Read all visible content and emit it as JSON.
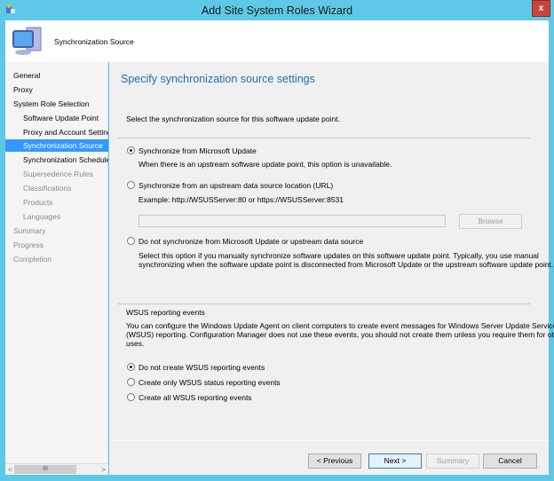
{
  "window": {
    "title": "Add Site System Roles Wizard",
    "close": "x"
  },
  "header": {
    "title": "Synchronization Source"
  },
  "nav": {
    "items": [
      {
        "label": "General",
        "level": 0,
        "state": "normal"
      },
      {
        "label": "Proxy",
        "level": 0,
        "state": "normal"
      },
      {
        "label": "System Role Selection",
        "level": 0,
        "state": "normal"
      },
      {
        "label": "Software Update Point",
        "level": 1,
        "state": "normal"
      },
      {
        "label": "Proxy and Account Settings",
        "level": 1,
        "state": "normal"
      },
      {
        "label": "Synchronization Source",
        "level": 1,
        "state": "selected"
      },
      {
        "label": "Synchronization Schedule",
        "level": 1,
        "state": "normal"
      },
      {
        "label": "Supersedence Rules",
        "level": 1,
        "state": "disabled"
      },
      {
        "label": "Classifications",
        "level": 1,
        "state": "disabled"
      },
      {
        "label": "Products",
        "level": 1,
        "state": "disabled"
      },
      {
        "label": "Languages",
        "level": 1,
        "state": "disabled"
      },
      {
        "label": "Summary",
        "level": 0,
        "state": "disabled"
      },
      {
        "label": "Progress",
        "level": 0,
        "state": "disabled"
      },
      {
        "label": "Completion",
        "level": 0,
        "state": "disabled"
      }
    ],
    "scroll_thumb": "III",
    "scroll_left": "<",
    "scroll_right": ">"
  },
  "main": {
    "heading": "Specify synchronization source settings",
    "intro": "Select the synchronization source for this software update point.",
    "source_options": [
      {
        "label": "Synchronize from Microsoft Update",
        "selected": true,
        "note": "When there is an upstream software update point, this option is unavailable."
      },
      {
        "label": "Synchronize from an upstream data source location (URL)",
        "selected": false,
        "note": "Example: http://WSUSServer:80 or https://WSUSServer:8531"
      },
      {
        "label": "Do not synchronize from Microsoft Update or upstream data source",
        "selected": false,
        "note": "Select this option if you manually synchronize software updates on this software update point. Typically, you use manual",
        "note2": "synchronizing when the software update point is disconnected from Microsoft Update or the upstream software update point."
      }
    ],
    "url_value": "",
    "browse": "Browse",
    "wsus": {
      "title": "WSUS reporting events",
      "desc": [
        "You can configure the Windows Update Agent on client computers to create event messages for Windows Server Update Services",
        "(WSUS) reporting. Configuration Manager does not use these events, you should not create them unless you require them for other",
        "uses."
      ],
      "options": [
        {
          "label": "Do not create WSUS reporting events",
          "selected": true
        },
        {
          "label": "Create only WSUS status reporting events",
          "selected": false
        },
        {
          "label": "Create all WSUS reporting events",
          "selected": false
        }
      ]
    }
  },
  "buttons": {
    "previous": "< Previous",
    "next": "Next >",
    "summary": "Summary",
    "cancel": "Cancel"
  }
}
